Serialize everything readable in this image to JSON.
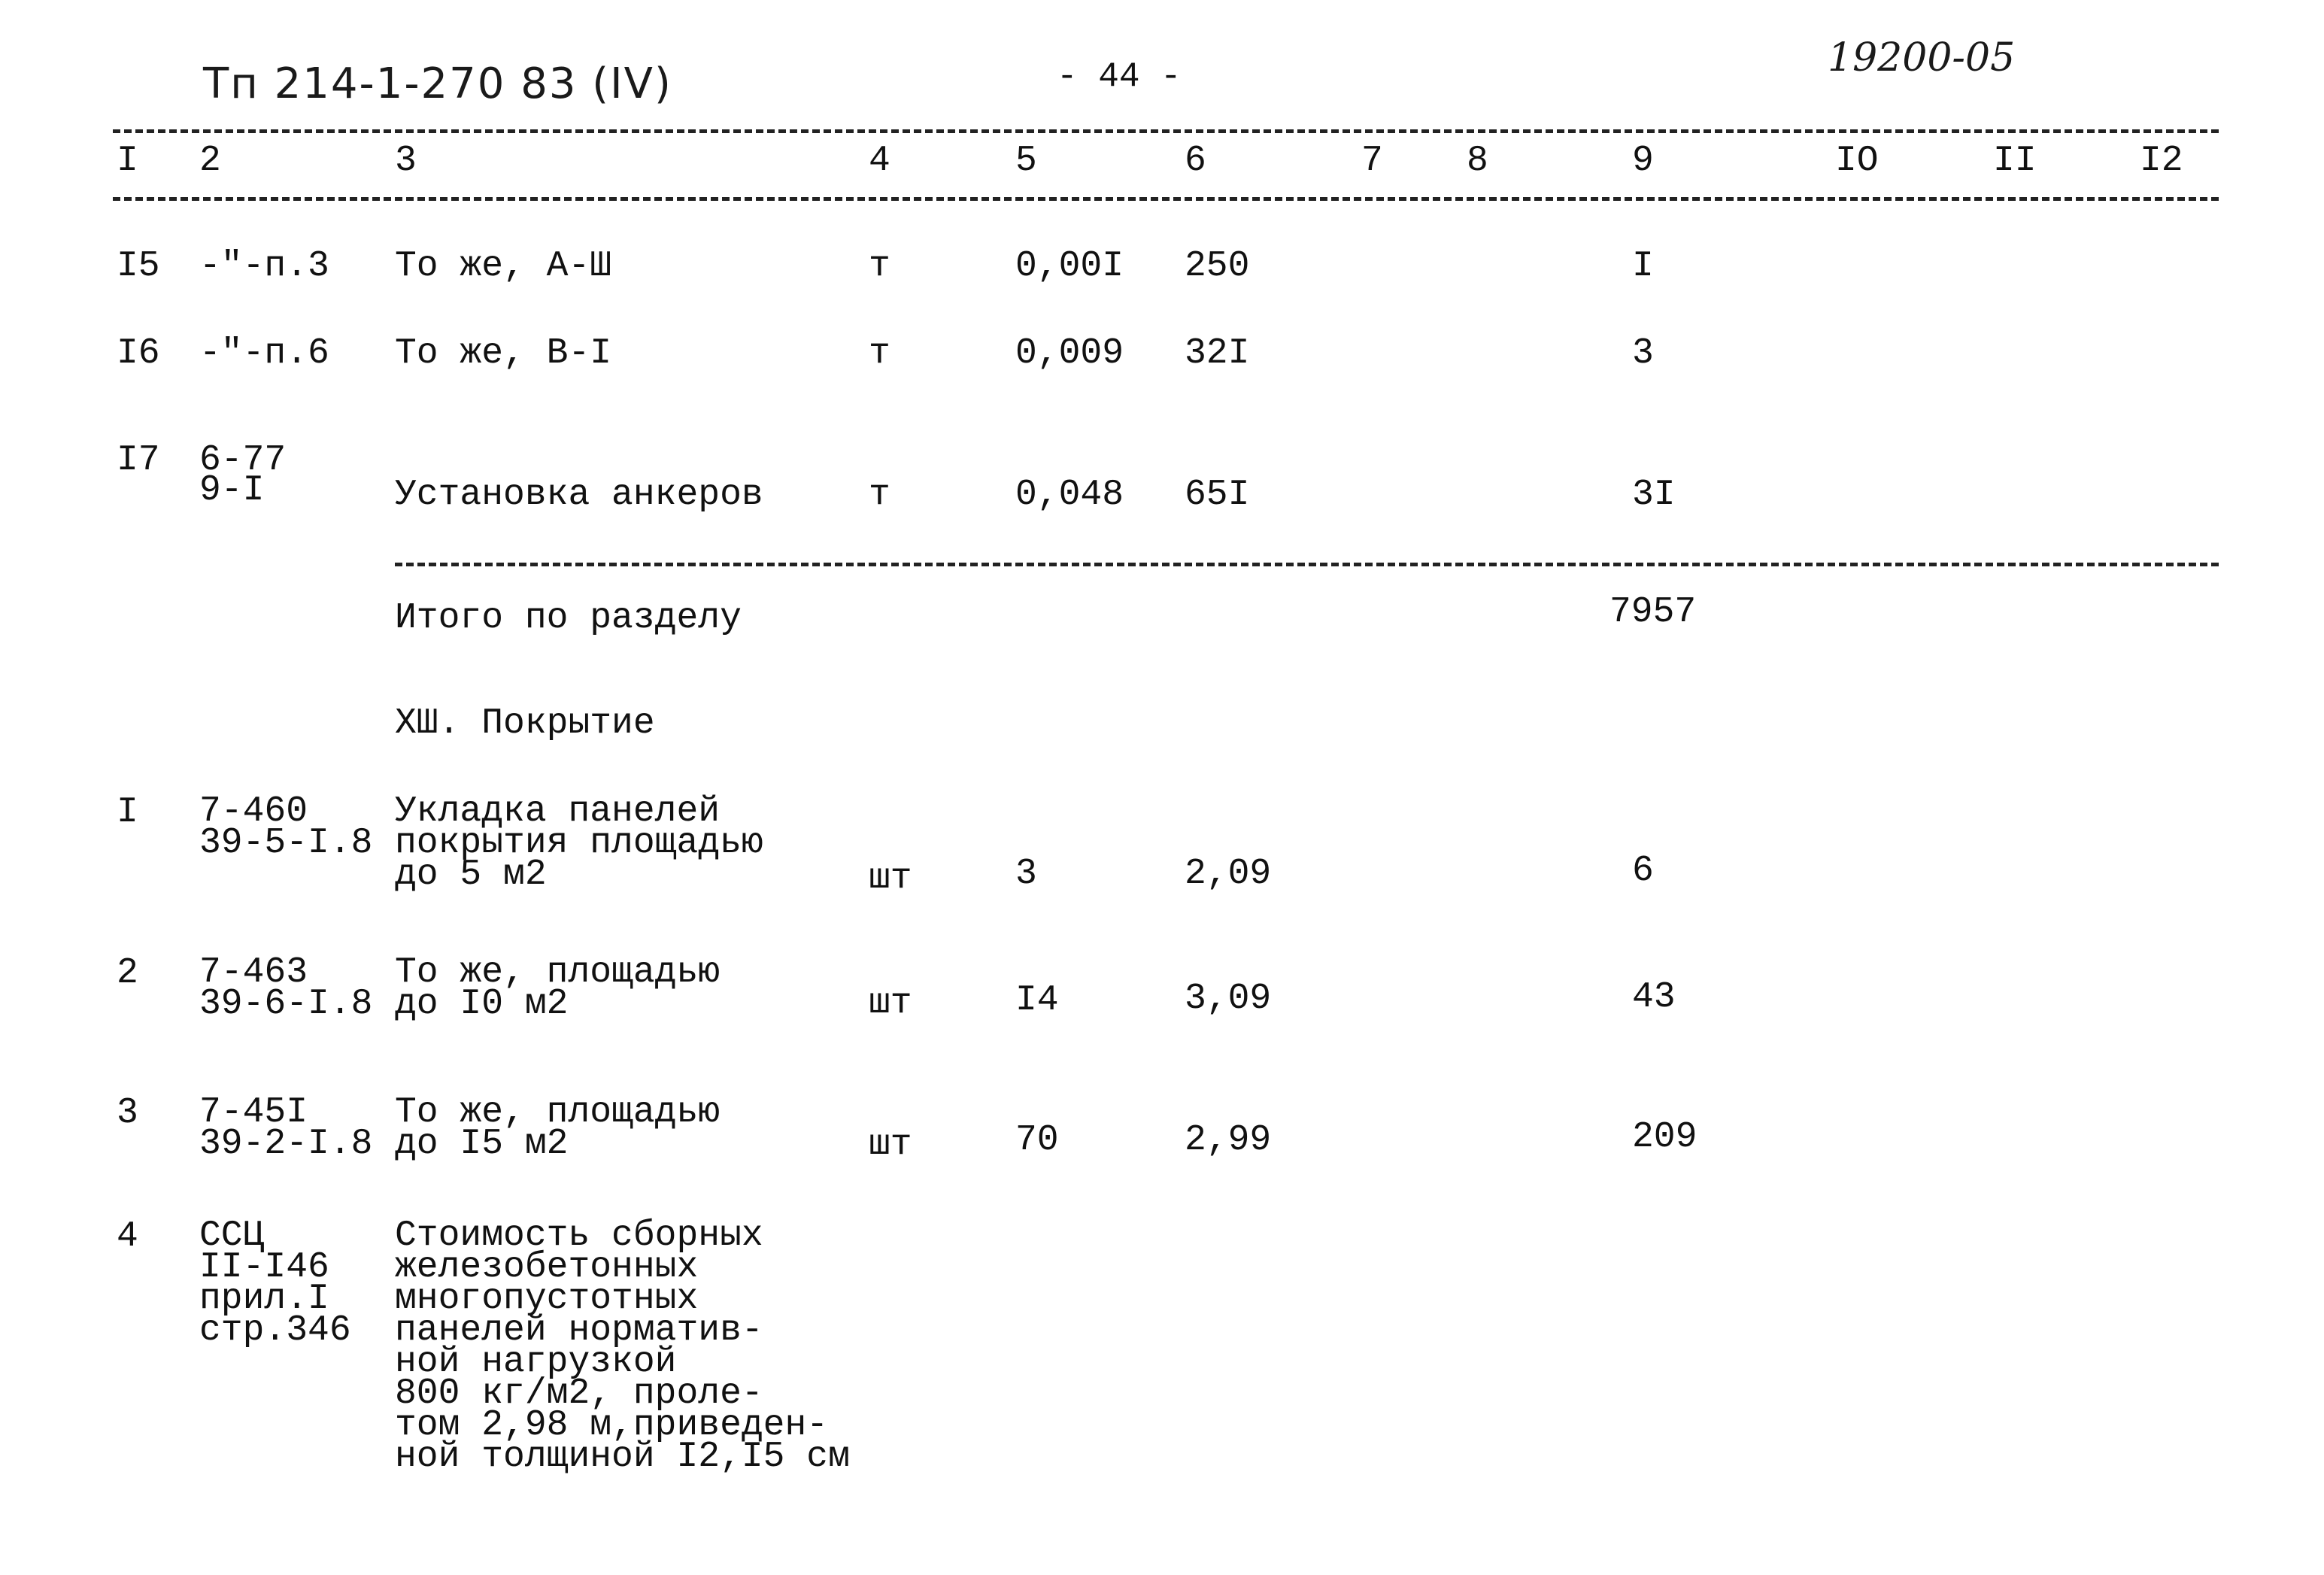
{
  "header": {
    "doc_code": "Тп 214-1-270 83 (IV)",
    "page_number": "- 44 -",
    "stamp": "19200-05"
  },
  "column_numbers": [
    "I",
    "2",
    "3",
    "4",
    "5",
    "6",
    "7",
    "8",
    "9",
    "IO",
    "II",
    "I2"
  ],
  "rows_top": [
    {
      "num": "I5",
      "code": "-\"-п.3",
      "name": "То же, А-Ш",
      "unit": "т",
      "qty": "0,00I",
      "price": "250",
      "total": "I"
    },
    {
      "num": "I6",
      "code": "-\"-п.6",
      "name": "То же, В-I",
      "unit": "т",
      "qty": "0,009",
      "price": "32I",
      "total": "3"
    },
    {
      "num": "I7",
      "code_line1": "6-77",
      "code_line2": "9-I",
      "name": "Установка анкеров",
      "unit": "т",
      "qty": "0,048",
      "price": "65I",
      "total": "3I"
    }
  ],
  "section_total": {
    "label": "Итого по разделу",
    "value": "7957"
  },
  "section_title": "XШ. Покрытие",
  "rows_section": [
    {
      "num": "I",
      "code": [
        "7-460",
        "39-5-I.8"
      ],
      "name": [
        "Укладка панелей",
        "покрытия площадью",
        "до 5 м2"
      ],
      "unit": "шт",
      "qty": "3",
      "price": "2,09",
      "total": "6"
    },
    {
      "num": "2",
      "code": [
        "7-463",
        "39-6-I.8"
      ],
      "name": [
        "То же, площадью",
        "до I0 м2"
      ],
      "unit": "шт",
      "qty": "I4",
      "price": "3,09",
      "total": "43"
    },
    {
      "num": "3",
      "code": [
        "7-45I",
        "39-2-I.8"
      ],
      "name": [
        "То же, площадью",
        "до I5 м2"
      ],
      "unit": "шт",
      "qty": "70",
      "price": "2,99",
      "total": "209"
    },
    {
      "num": "4",
      "code": [
        "ССЦ",
        "II-I46",
        "прил.I",
        "стр.346"
      ],
      "name": [
        "Стоимость сборных",
        "железобетонных",
        "многопустотных",
        "панелей норматив-",
        "ной нагрузкой",
        "800 кг/м2, проле-",
        "том 2,98 м,приведен-",
        "ной толщиной I2,I5 см"
      ]
    }
  ]
}
